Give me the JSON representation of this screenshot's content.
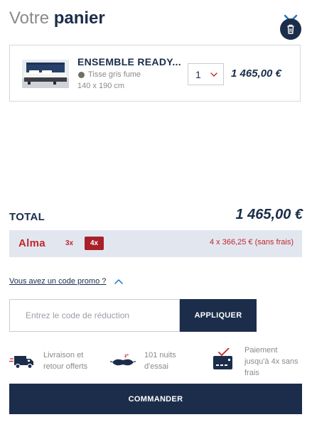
{
  "header": {
    "title_light": "Votre",
    "title_bold": "panier",
    "close_icon": "close-icon"
  },
  "cart_item": {
    "name": "ENSEMBLE READY...",
    "color": "Tisse gris fume",
    "color_swatch": "#6e7263",
    "size": "140 x 190 cm",
    "quantity": "1",
    "price": "1 465,00 €"
  },
  "summary": {
    "total_label": "TOTAL",
    "total_value": "1 465,00 €"
  },
  "alma": {
    "logo": "Alma",
    "option_3x": "3x",
    "option_4x": "4x",
    "installment_text": "4 x 366,25 € (sans frais)",
    "brand_color": "#c0272d"
  },
  "promo": {
    "link_text": "Vous avez un code promo ?",
    "placeholder": "Entrez le code de réduction",
    "apply_label": "APPLIQUER"
  },
  "features": [
    {
      "icon": "delivery-truck-icon",
      "line1": "Livraison et",
      "line2": "retour offerts"
    },
    {
      "icon": "sleep-mask-icon",
      "line1": "101 nuits",
      "line2": "d'essai"
    },
    {
      "icon": "credit-card-icon",
      "line1": "Paiement",
      "line2": "jusqu'à 4x sans",
      "line3": "frais"
    }
  ],
  "checkout": {
    "order_label": "COMMANDER"
  },
  "colors": {
    "navy": "#1b2d4a",
    "accent_blue": "#1a73c7",
    "alma_red": "#c0272d",
    "alma_bg": "#e2e7ef"
  }
}
